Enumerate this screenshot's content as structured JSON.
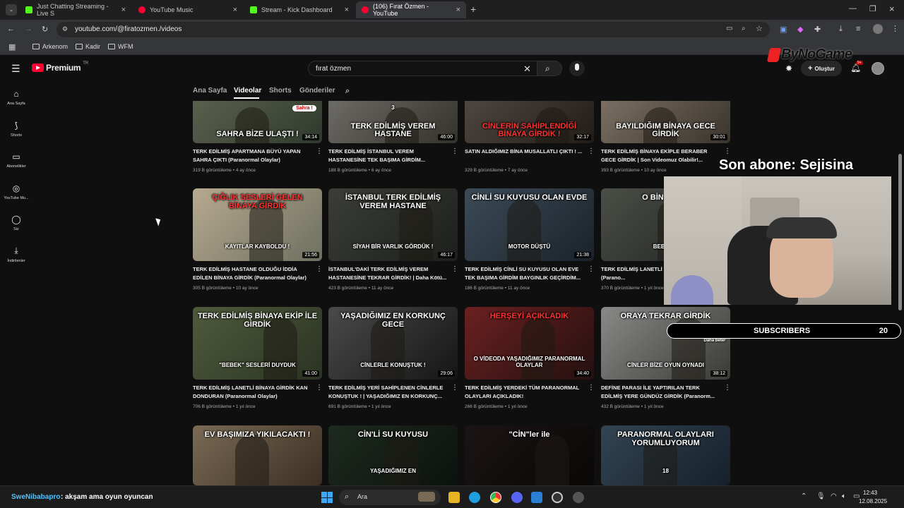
{
  "tabs": [
    {
      "label": "Just Chatting Streaming - Live S",
      "icon": "kick-icon"
    },
    {
      "label": "YouTube Music",
      "icon": "youtube-music-icon"
    },
    {
      "label": "Stream - Kick Dashboard",
      "icon": "kick-icon"
    },
    {
      "label": "(106) Fırat Özmen - YouTube",
      "icon": "youtube-icon"
    }
  ],
  "address": {
    "url": "youtube.com/@firatozmen./videos"
  },
  "bookmarks": [
    "Arkenom",
    "Kadir",
    "WFM"
  ],
  "youtube": {
    "brand": "Premium",
    "region": "TR",
    "search_value": "fırat özmen",
    "create_label": "Oluştur",
    "notif_count": "9+"
  },
  "sidebar": [
    {
      "label": "Ana Sayfa",
      "icon": "home-icon"
    },
    {
      "label": "Shorts",
      "icon": "shorts-icon"
    },
    {
      "label": "Abonelikler",
      "icon": "subscriptions-icon"
    },
    {
      "label": "YouTube Mu...",
      "icon": "youtube-music-icon"
    },
    {
      "label": "Siz",
      "icon": "user-icon"
    },
    {
      "label": "İndirilenler",
      "icon": "download-icon"
    }
  ],
  "channel_tabs": [
    "Ana Sayfa",
    "Videolar",
    "Shorts",
    "Gönderiler"
  ],
  "videos": [
    {
      "title": "TERK EDİLMİŞ APARTMANA BÜYÜ YAPAN SAHRA ÇIKTI (Paranormal Olaylar)",
      "views": "319 B görüntüleme",
      "age": "4 ay önce",
      "duration": "34:14",
      "thumb_text": "SAHRA BİZE ULAŞTI !",
      "thumb_extra": "Sahra !"
    },
    {
      "title": "TERK EDİLMİŞ İSTANBUL VEREM HASTANESİNE TEK BAŞIMA GİRDİM...",
      "views": "188 B görüntüleme",
      "age": "6 ay önce",
      "duration": "46:00",
      "thumb_text": "TERK EDİLMİŞ VEREM HASTANE",
      "thumb_extra": "3"
    },
    {
      "title": "SATIN ALDIĞIMIZ BİNA MUSALLATLI ÇIKTI ! ...",
      "views": "329 B görüntüleme",
      "age": "7 ay önce",
      "duration": "32:17",
      "thumb_text": "CİNLERİN SAHİPLENDİĞİ BİNAYA GİRDİK !",
      "thumb_extra": ""
    },
    {
      "title": "TERK EDİLMİŞ BİNAYA EKİPLE BERABER GECE GİRDİK | Son Videomuz Olabilir!...",
      "views": "393 B görüntüleme",
      "age": "10 ay önce",
      "duration": "30:01",
      "thumb_text": "BAYILDIĞIM BİNAYA GECE GİRDİK",
      "thumb_extra": ""
    },
    {
      "title": "TERK EDİLMİŞ HASTANE OLDUĞU İDDİA EDİLEN BİNAYA GİRDİK (Paranormal Olaylar)",
      "views": "305 B görüntüleme",
      "age": "10 ay önce",
      "duration": "21:56",
      "thumb_text": "ÇIĞLIK SESLERİ GELEN BİNAYA GİRDİK",
      "thumb_extra": "KAYITLAR KAYBOLDU !"
    },
    {
      "title": "İSTANBUL'DAKİ TERK EDİLMİŞ VEREM HASTANESİNE TEKRAR GİRDİK! | Daha Kötü...",
      "views": "423 B görüntüleme",
      "age": "11 ay önce",
      "duration": "46:17",
      "thumb_text": "İSTANBUL TERK EDİLMİŞ VEREM HASTANE",
      "thumb_extra": "SİYAH BİR VARLIK GÖRDÜK !"
    },
    {
      "title": "TERK EDİLMİŞ CİNLİ SU KUYUSU OLAN EVE TEK BAŞIMA GİRDİM BAYGINLIK GEÇİRDİM...",
      "views": "186 B görüntüleme",
      "age": "11 ay önce",
      "duration": "21:38",
      "thumb_text": "CİNLİ SU KUYUSU OLAN EVDE",
      "thumb_extra": "MOTOR DÜŞTÜ"
    },
    {
      "title": "TERK EDİLMİŞ LANETLİ ... KİŞİ GİRDİK (Parano...",
      "views": "370 B görüntüleme",
      "age": "1 yıl önce",
      "duration": "",
      "thumb_text": "O BİNAYA 00",
      "thumb_extra": "BEBEK S"
    },
    {
      "title": "TERK EDİLMİŞ LANETLİ BİNAYA GİRDİK KAN DONDURAN (Paranormal Olaylar)",
      "views": "706 B görüntüleme",
      "age": "1 yıl önce",
      "duration": "41:00",
      "thumb_text": "TERK EDİLMİŞ BİNAYA EKİP İLE GİRDİK",
      "thumb_extra": "\"BEBEK\" SESLERİ DUYDUK"
    },
    {
      "title": "TERK EDİLMİŞ YERİ SAHİPLENEN CİNLERLE KONUŞTUK ! | YAŞADIĞIMIZ EN KORKUNÇ...",
      "views": "691 B görüntüleme",
      "age": "1 yıl önce",
      "duration": "29:06",
      "thumb_text": "YAŞADIĞIMIZ EN KORKUNÇ GECE",
      "thumb_extra": "CİNLERLE KONUŞTUK !"
    },
    {
      "title": "TERK EDİLMİŞ YERDEKİ TÜM PARANORMAL OLAYLARI AÇIKLADIK!",
      "views": "266 B görüntüleme",
      "age": "1 yıl önce",
      "duration": "34:40",
      "thumb_text": "HERŞEYİ AÇIKLADIK",
      "thumb_extra": "O VİDEODA YAŞADIĞIMIZ PARANORMAL OLAYLAR"
    },
    {
      "title": "DEFİNE PARASI İLE YAPTIRILAN TERK EDİLMİŞ YERE GÜNDÜZ GİRDİK (Paranorm...",
      "views": "432 B görüntüleme",
      "age": "1 yıl önce",
      "duration": "38:12",
      "thumb_text": "ORAYA TEKRAR GİRDİK",
      "thumb_extra": "CİNLER BİZE OYUN OYNADI"
    },
    {
      "title": "",
      "views": "",
      "age": "",
      "duration": "",
      "thumb_text": "EV BAŞIMIZA YIKILACAKTI !",
      "thumb_extra": ""
    },
    {
      "title": "",
      "views": "",
      "age": "",
      "duration": "",
      "thumb_text": "CİN'Lİ SU KUYUSU",
      "thumb_extra": "YAŞADIĞIMIZ EN"
    },
    {
      "title": "",
      "views": "",
      "age": "",
      "duration": "",
      "thumb_text": "\"CİN\"ler ile",
      "thumb_extra": ""
    },
    {
      "title": "",
      "views": "",
      "age": "",
      "duration": "",
      "thumb_text": "PARANORMAL OLAYLARI YORUMLUYORUM",
      "thumb_extra": "18"
    }
  ],
  "overlay": {
    "watermark": "ByNoGame",
    "last_sub": "Son abone: Sejisina",
    "subs_label": "SUBSCRIBERS",
    "subs_count": "20",
    "chat_user": "SweNibabapro",
    "chat_msg": ": akşam ama oyun oyuncan",
    "badge": "2",
    "card_note": "Gündüz Geceden Daha beter"
  },
  "taskbar": {
    "search_label": "Ara",
    "time": "12:43",
    "date": "12.08.2025"
  },
  "colors": {
    "yt_red": "#ff0033",
    "kick_green": "#53fc18",
    "bg": "#0f0f0f"
  }
}
